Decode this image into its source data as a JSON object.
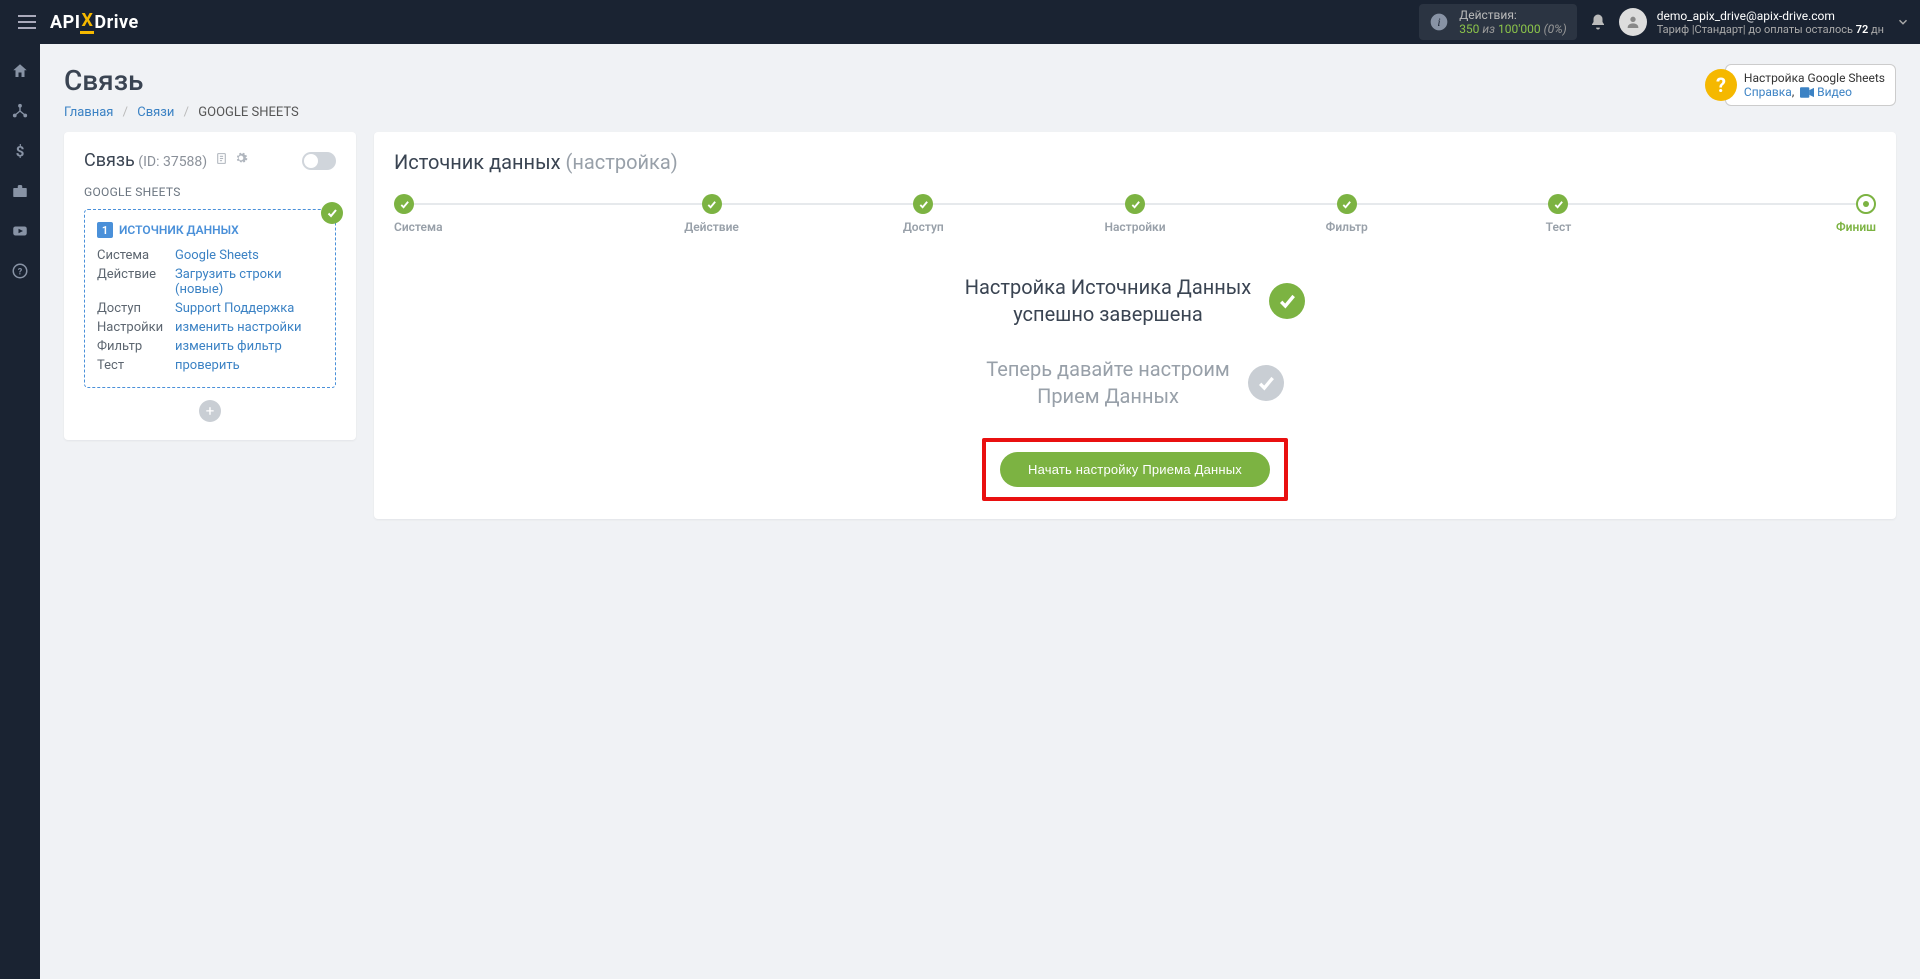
{
  "header": {
    "logo": {
      "api": "API",
      "x": "X",
      "drive": "Drive"
    },
    "actions": {
      "label": "Действия:",
      "used": "350",
      "of": "из",
      "total": "100'000",
      "pct": "(0%)"
    },
    "user": {
      "email": "demo_apix_drive@apix-drive.com",
      "tariff_prefix": "Тариф |Стандарт| до оплаты осталось ",
      "days": "72",
      "days_suffix": " дн"
    }
  },
  "page": {
    "title": "Связь",
    "breadcrumb": {
      "home": "Главная",
      "links": "Связи",
      "current": "GOOGLE SHEETS"
    }
  },
  "help": {
    "title": "Настройка Google Sheets",
    "ref": "Справка",
    "video": "Видео"
  },
  "side": {
    "title": "Связь",
    "id_prefix": "(ID: ",
    "id": "37588",
    "id_suffix": ")",
    "sub": "GOOGLE SHEETS",
    "source_header": "ИСТОЧНИК ДАННЫХ",
    "rows": [
      {
        "k": "Система",
        "v": "Google Sheets"
      },
      {
        "k": "Действие",
        "v": "Загрузить строки (новые)"
      },
      {
        "k": "Доступ",
        "v": "Support Поддержка"
      },
      {
        "k": "Настройки",
        "v": "изменить настройки"
      },
      {
        "k": "Фильтр",
        "v": "изменить фильтр"
      },
      {
        "k": "Тест",
        "v": "проверить"
      }
    ]
  },
  "mainCard": {
    "title": "Источник данных",
    "subtitle": "(настройка)",
    "steps": [
      "Система",
      "Действие",
      "Доступ",
      "Настройки",
      "Фильтр",
      "Тест",
      "Финиш"
    ],
    "msg1_line1": "Настройка Источника Данных",
    "msg1_line2": "успешно завершена",
    "msg2_line1": "Теперь давайте настроим",
    "msg2_line2": "Прием Данных",
    "cta": "Начать настройку Приема Данных"
  }
}
